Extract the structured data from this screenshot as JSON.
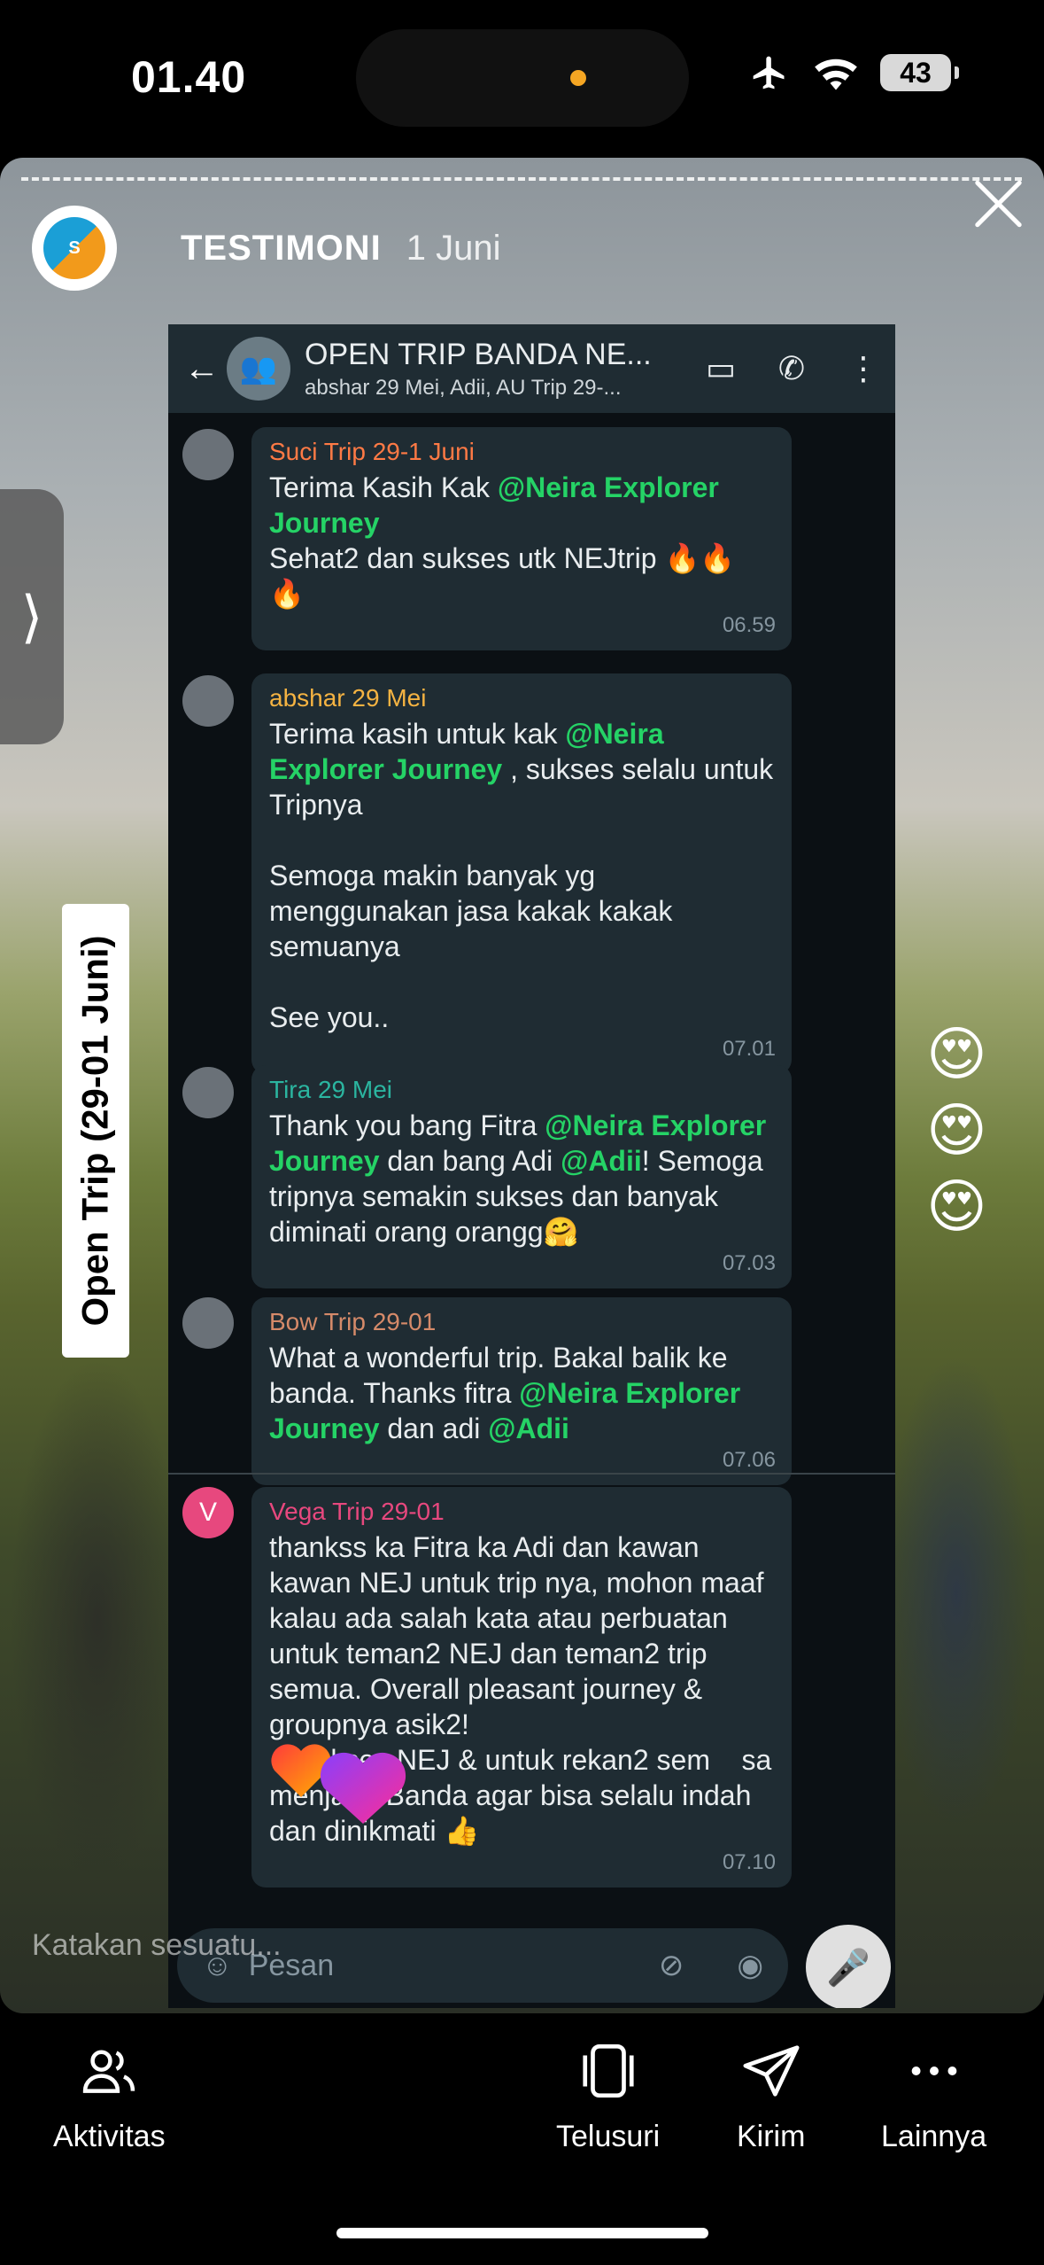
{
  "status_bar": {
    "time": "01.40",
    "battery": "43"
  },
  "story": {
    "account_name": "TESTIMONI",
    "date": "1 Juni",
    "vertical_label": "Open Trip (29-01 Juni)",
    "reply_placeholder": "Katakan sesuatu...",
    "side_emojis": [
      "😍",
      "😍",
      "😍"
    ]
  },
  "whatsapp": {
    "group_title": "OPEN TRIP BANDA NE...",
    "group_subtitle": "abshar 29 Mei, Adii, AU Trip 29-...",
    "input_placeholder": "Pesan",
    "messages": [
      {
        "sender": "Suci Trip 29-1 Juni",
        "sender_color": "#ff7a45",
        "text_before": "Terima Kasih Kak ",
        "mention": "@Neira Explorer Journey",
        "text_after": "\nSehat2 dan sukses utk NEJtrip 🔥🔥\n🔥",
        "time": "06.59"
      },
      {
        "sender": "abshar 29 Mei",
        "sender_color": "#f5b342",
        "text_before": "Terima kasih untuk kak ",
        "mention": "@Neira Explorer Journey",
        "text_after": " , sukses selalu untuk Tripnya\n\nSemoga makin banyak yg menggunakan jasa kakak kakak semuanya\n\nSee you..",
        "time": "07.01"
      },
      {
        "sender": "Tira 29 Mei",
        "sender_color": "#2bb5a0",
        "text_before": "Thank you bang Fitra ",
        "mention": "@Neira Explorer Journey",
        "text_middle": " dan bang Adi ",
        "mention2": "@Adii",
        "text_after": "! Semoga tripnya semakin sukses dan banyak diminati orang orangg🤗",
        "time": "07.03"
      },
      {
        "sender": "Bow Trip 29-01",
        "sender_color": "#d58a69",
        "text_before": "What a wonderful trip. Bakal balik ke banda. Thanks fitra ",
        "mention": "@Neira Explorer Journey",
        "text_middle": " dan adi ",
        "mention2": "@Adii",
        "text_after": "",
        "time": "07.06"
      },
      {
        "sender": "Vega Trip 29-01",
        "sender_color": "#e7487e",
        "avatar_letter": "V",
        "text_before": "thankss ka Fitra ka Adi dan kawan kawan NEJ untuk trip nya, mohon maaf kalau ada salah kata atau perbuatan untuk teman2 NEJ dan teman2 trip semua. Overall pleasant journey & groupnya asik2!\n    sukses NEJ & untuk rekan2 sem    sa menjaga Banda agar bisa selalu indah dan dinikmati 👍",
        "time": "07.10"
      }
    ]
  },
  "bottom_nav": [
    {
      "label": "Aktivitas",
      "icon": "people-icon"
    },
    {
      "label": "Telusuri",
      "icon": "phone-frame-icon"
    },
    {
      "label": "Kirim",
      "icon": "send-icon"
    },
    {
      "label": "Lainnya",
      "icon": "more-icon"
    }
  ]
}
